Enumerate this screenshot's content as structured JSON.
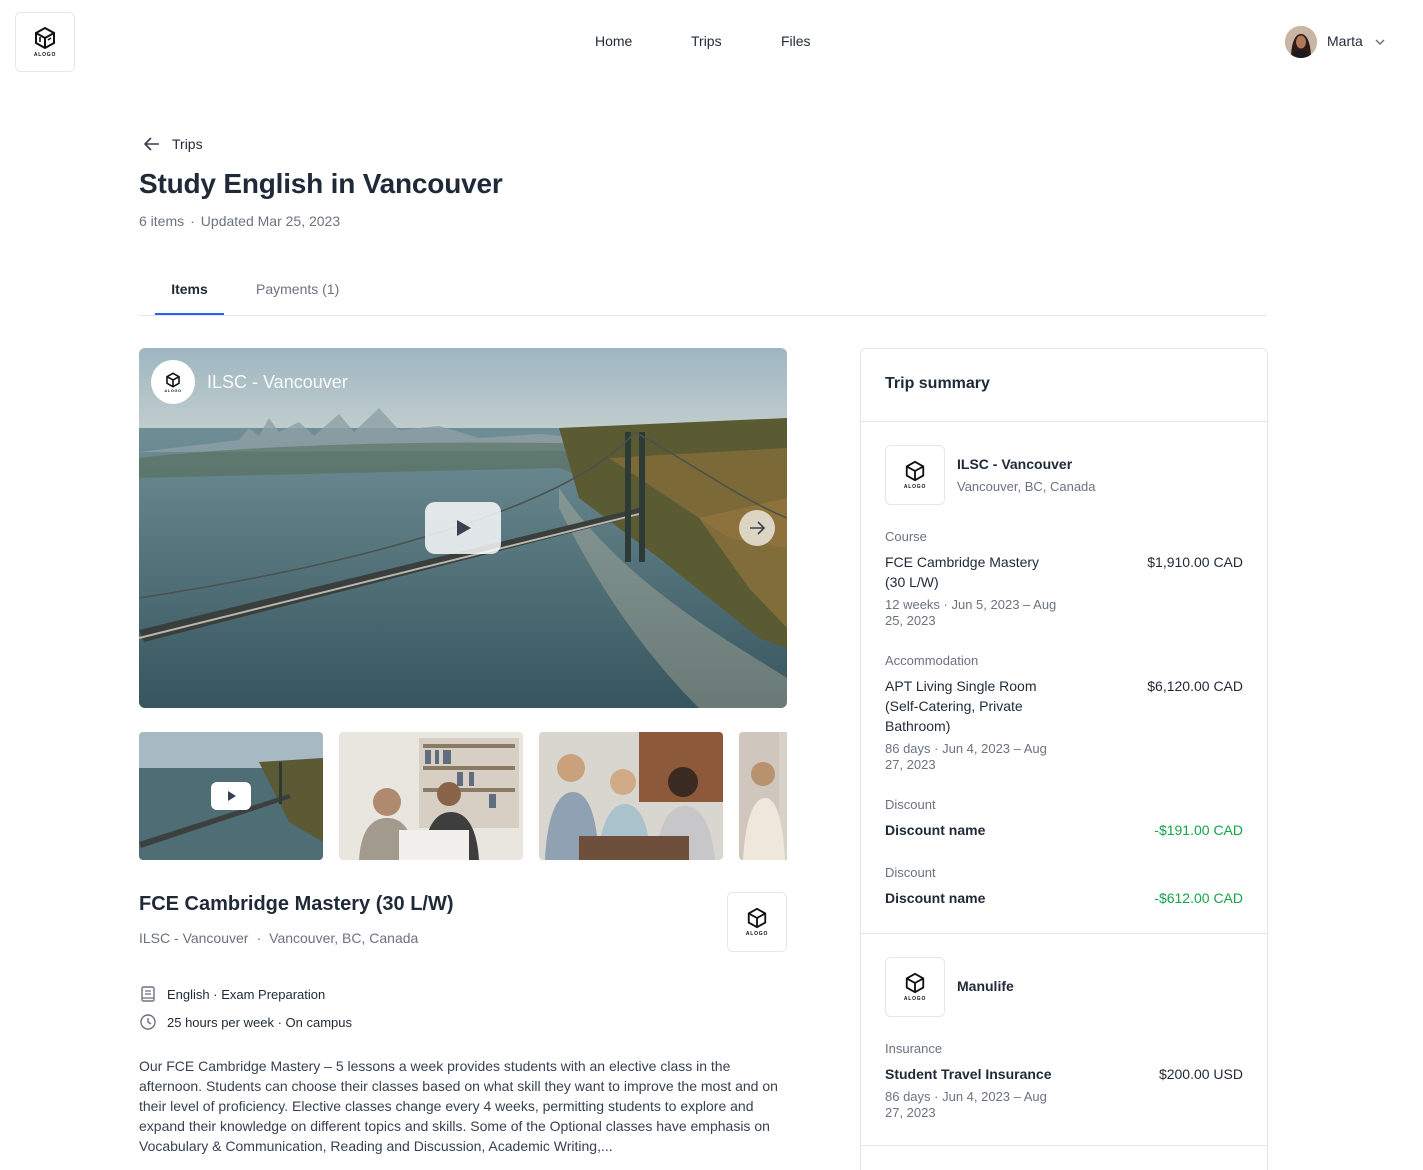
{
  "nav": {
    "logo_text": "ALOGO",
    "links": [
      "Home",
      "Trips",
      "Files"
    ],
    "user_name": "Marta"
  },
  "header": {
    "back_label": "Trips",
    "title": "Study English in Vancouver",
    "item_count": "6 items",
    "separator": "·",
    "updated": "Updated Mar 25, 2023"
  },
  "tabs": [
    {
      "label": "Items",
      "active": true
    },
    {
      "label": "Payments (1)",
      "active": false
    }
  ],
  "media": {
    "hero_title": "ILSC - Vancouver",
    "thumbnail_count": 4
  },
  "course": {
    "title": "FCE Cambridge Mastery (30 L/W)",
    "provider": "ILSC - Vancouver",
    "separator": "·",
    "location": "Vancouver, BC, Canada",
    "features": [
      {
        "icon": "book-icon",
        "text": "English · Exam Preparation"
      },
      {
        "icon": "clock-icon",
        "text": "25 hours per week · On campus"
      }
    ],
    "description": "Our FCE Cambridge Mastery – 5 lessons a week provides students with an elective class in the afternoon. Students can choose their classes based on what skill they want to improve the most and on their level of proficiency. Elective classes change every 4 weeks, permitting students to explore and expand their knowledge on different topics and skills. Some of the Optional classes have emphasis on Vocabulary & Communication, Reading and Discussion, Academic Writing,..."
  },
  "summary": {
    "title": "Trip summary",
    "providers": [
      {
        "name": "ILSC - Vancouver",
        "location": "Vancouver, BC, Canada",
        "items": [
          {
            "section": "Course",
            "name": "FCE Cambridge Mastery (30 L/W)",
            "detail": "12 weeks · Jun 5, 2023 – Aug 25, 2023",
            "price": "$1,910.00 CAD"
          },
          {
            "section": "Accommodation",
            "name": "APT Living Single Room (Self-Catering, Private Bathroom)",
            "detail": "86 days · Jun 4, 2023 – Aug 27, 2023",
            "price": "$6,120.00 CAD"
          },
          {
            "section": "Discount",
            "name": "Discount name",
            "price": "-$191.00 CAD"
          },
          {
            "section": "Discount",
            "name": "Discount name",
            "price": "-$612.00 CAD"
          }
        ]
      },
      {
        "name": "Manulife",
        "items": [
          {
            "section": "Insurance",
            "name": "Student Travel Insurance",
            "detail": "86 days · Jun 4, 2023 – Aug 27, 2023",
            "price": "$200.00 USD"
          }
        ]
      }
    ]
  },
  "colors": {
    "accent": "#2563eb",
    "text": "#1f2937",
    "muted": "#6b7280",
    "discount": "#16a34a",
    "border": "#e5e7eb"
  }
}
